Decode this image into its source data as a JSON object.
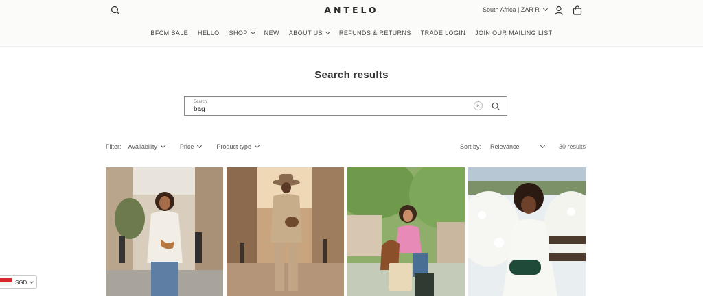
{
  "header": {
    "logo": "ANTELO",
    "locale": "South Africa | ZAR R",
    "icons": {
      "search": "search-icon",
      "account": "user-icon",
      "cart": "bag-icon"
    }
  },
  "nav": [
    {
      "label": "BFCM SALE",
      "dropdown": false
    },
    {
      "label": "HELLO",
      "dropdown": false
    },
    {
      "label": "SHOP",
      "dropdown": true
    },
    {
      "label": "NEW",
      "dropdown": false
    },
    {
      "label": "ABOUT US",
      "dropdown": true
    },
    {
      "label": "REFUNDS & RETURNS",
      "dropdown": false
    },
    {
      "label": "TRADE LOGIN",
      "dropdown": false
    },
    {
      "label": "JOIN OUR MAILING LIST",
      "dropdown": false
    }
  ],
  "page": {
    "title": "Search results"
  },
  "search": {
    "label": "Search",
    "value": "bag",
    "clear_icon": "×"
  },
  "filters": {
    "label": "Filter:",
    "items": [
      "Availability",
      "Price",
      "Product type"
    ]
  },
  "sort": {
    "label": "Sort by:",
    "selected": "Relevance"
  },
  "results": {
    "count": "30 results"
  },
  "products": [
    {
      "image": "woman-crossbody-bag-street"
    },
    {
      "image": "man-hat-suit-bag-street"
    },
    {
      "image": "woman-pink-top-tote-bag"
    },
    {
      "image": "woman-white-dress-belt-bag-flowers"
    }
  ],
  "currency": {
    "code": "SGD"
  },
  "colors": {
    "text": "#3a3a3a",
    "border": "#8a8a8a",
    "header_bg": "#fbfbfa"
  }
}
